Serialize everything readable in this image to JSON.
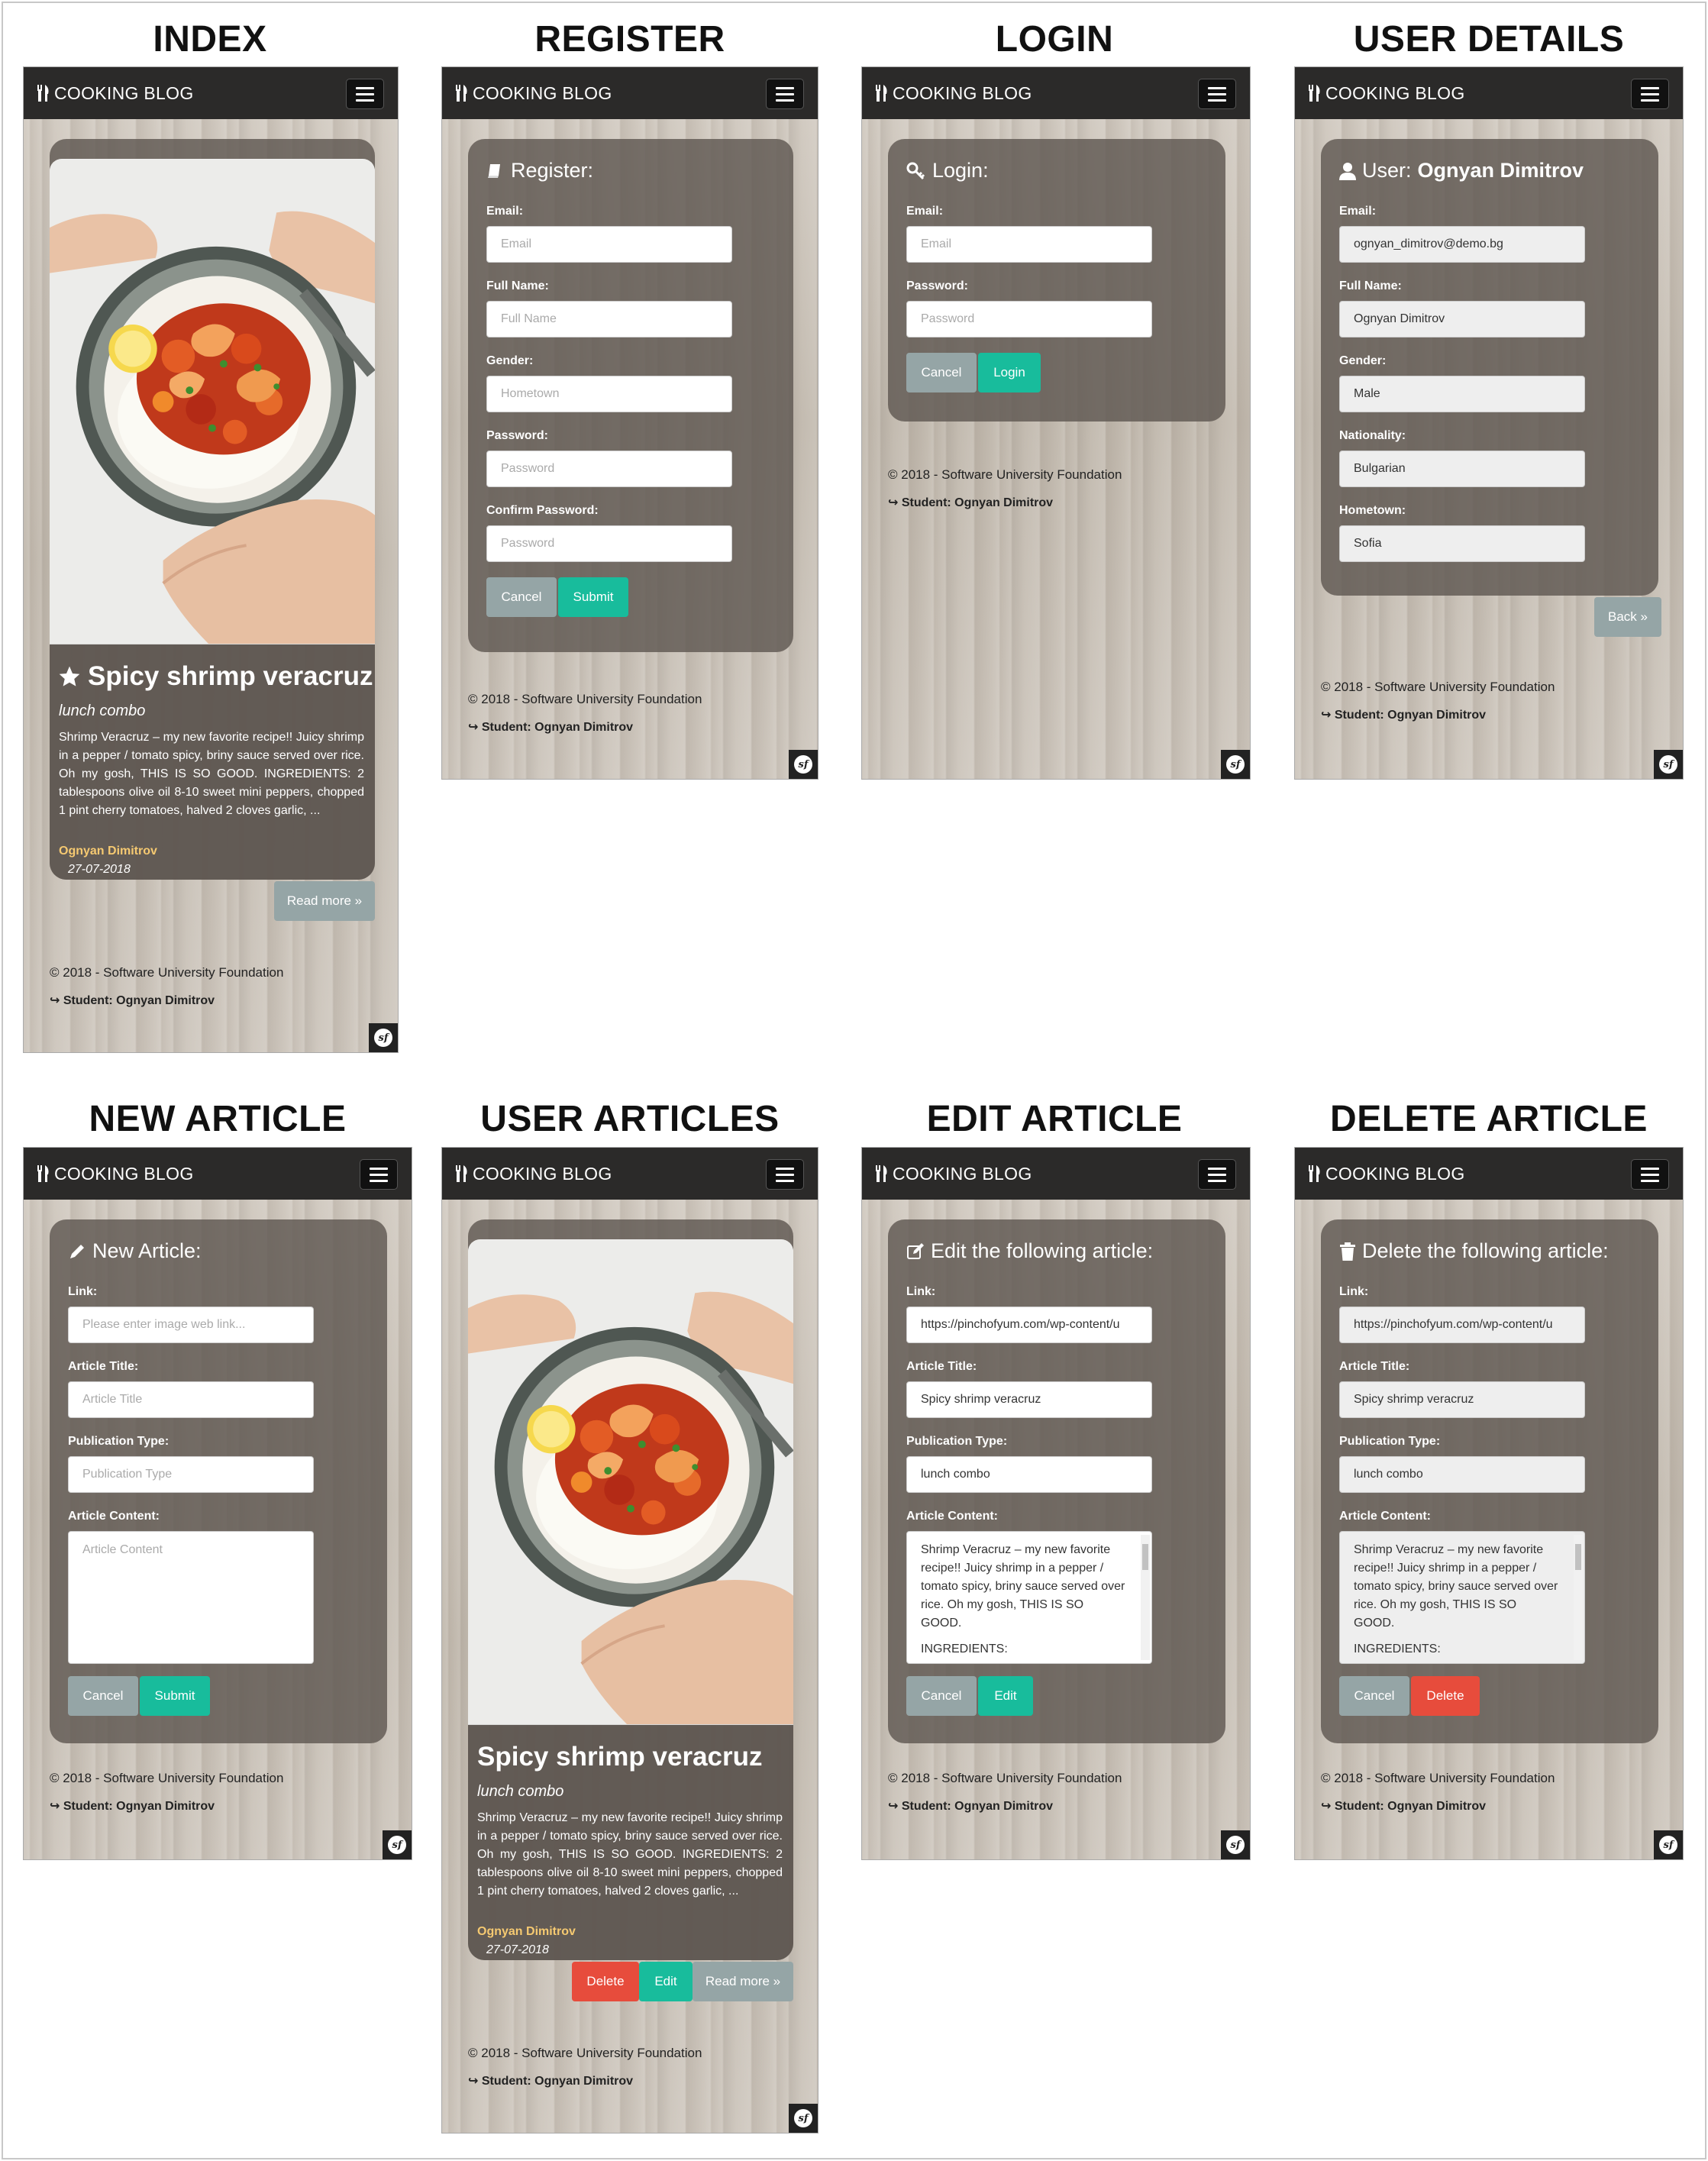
{
  "titles": {
    "index": "INDEX",
    "register": "REGISTER",
    "login": "LOGIN",
    "user_details": "USER DETAILS",
    "new_article": "NEW ARTICLE",
    "user_articles": "USER ARTICLES",
    "edit_article": "EDIT ARTICLE",
    "delete_article": "DELETE ARTICLE"
  },
  "brand": "COOKING BLOG",
  "footer": {
    "copyright": "© 2018 - Software University Foundation",
    "student": "↪ Student: Ognyan Dimitrov"
  },
  "article": {
    "title": "Spicy shrimp veracruz",
    "type": "lunch combo",
    "excerpt": "Shrimp Veracruz – my new favorite recipe!! Juicy shrimp in a pepper / tomato spicy, briny sauce served over rice. Oh my gosh, THIS IS SO GOOD. INGREDIENTS: 2 tablespoons olive oil 8-10 sweet mini peppers, chopped 1 pint cherry tomatoes, halved 2 cloves garlic, ...",
    "author": "Ognyan Dimitrov",
    "date": "27-07-2018",
    "read_more": "Read more »",
    "delete": "Delete",
    "edit": "Edit"
  },
  "register": {
    "heading": "Register:",
    "email_label": "Email:",
    "email_placeholder": "Email",
    "fullname_label": "Full Name:",
    "fullname_placeholder": "Full Name",
    "gender_label": "Gender:",
    "gender_placeholder": "Hometown",
    "password_label": "Password:",
    "password_placeholder": "Password",
    "confirm_label": "Confirm Password:",
    "confirm_placeholder": "Password",
    "cancel": "Cancel",
    "submit": "Submit"
  },
  "login": {
    "heading": "Login:",
    "email_label": "Email:",
    "email_placeholder": "Email",
    "password_label": "Password:",
    "password_placeholder": "Password",
    "cancel": "Cancel",
    "login": "Login"
  },
  "user": {
    "heading_prefix": "User:",
    "heading_name": "Ognyan Dimitrov",
    "email_label": "Email:",
    "email": "ognyan_dimitrov@demo.bg",
    "fullname_label": "Full Name:",
    "fullname": "Ognyan Dimitrov",
    "gender_label": "Gender:",
    "gender": "Male",
    "nationality_label": "Nationality:",
    "nationality": "Bulgarian",
    "hometown_label": "Hometown:",
    "hometown": "Sofia",
    "back": "Back »"
  },
  "new_article": {
    "heading": "New Article:",
    "link_label": "Link:",
    "link_placeholder": "Please enter image web link...",
    "title_label": "Article Title:",
    "title_placeholder": "Article Title",
    "type_label": "Publication Type:",
    "type_placeholder": "Publication Type",
    "content_label": "Article Content:",
    "content_placeholder": "Article Content",
    "cancel": "Cancel",
    "submit": "Submit"
  },
  "edit_article": {
    "heading": "Edit the following article:",
    "link_label": "Link:",
    "link": "https://pinchofyum.com/wp-content/u",
    "title_label": "Article Title:",
    "title": "Spicy shrimp veracruz",
    "type_label": "Publication Type:",
    "type": "lunch combo",
    "content_label": "Article Content:",
    "content": "Shrimp Veracruz – my new favorite recipe!! Juicy shrimp in a pepper / tomato spicy, briny sauce served over rice. Oh my gosh, THIS IS SO GOOD.",
    "content_more": "INGREDIENTS:",
    "cancel": "Cancel",
    "edit": "Edit"
  },
  "delete_article": {
    "heading": "Delete the following article:",
    "link_label": "Link:",
    "link": "https://pinchofyum.com/wp-content/u",
    "title_label": "Article Title:",
    "title": "Spicy shrimp veracruz",
    "type_label": "Publication Type:",
    "type": "lunch combo",
    "content_label": "Article Content:",
    "content": "Shrimp Veracruz – my new favorite recipe!! Juicy shrimp in a pepper / tomato spicy, briny sauce served over rice. Oh my gosh, THIS IS SO GOOD.",
    "content_more": "INGREDIENTS:",
    "cancel": "Cancel",
    "delete": "Delete"
  },
  "colors": {
    "navbar": "#2b2a29",
    "teal": "#18bc9c",
    "gray_button": "#95a5a6",
    "red": "#e74c3c",
    "author": "#f5c971"
  }
}
